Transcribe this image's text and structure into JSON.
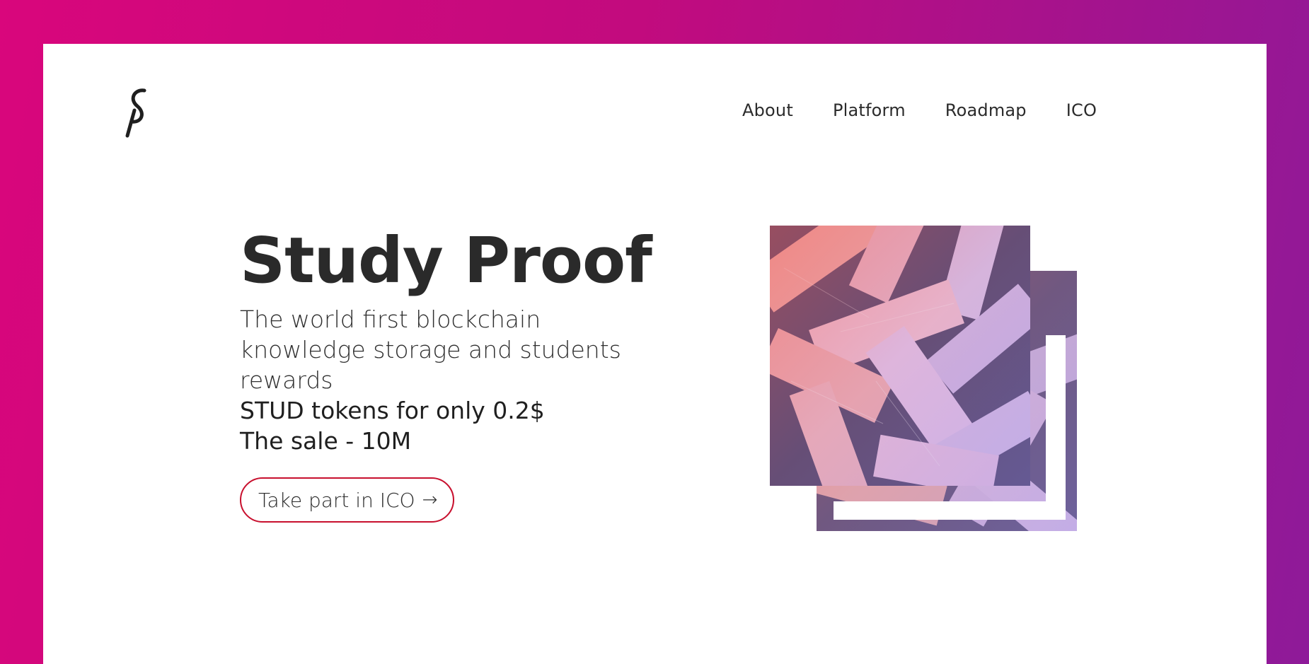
{
  "brand": {
    "logo_text": "ṡ",
    "icon": "studyproof-logo-icon"
  },
  "nav": {
    "items": [
      {
        "label": "About"
      },
      {
        "label": "Platform"
      },
      {
        "label": "Roadmap"
      },
      {
        "label": "ICO"
      }
    ]
  },
  "hero": {
    "title": "Study Proof",
    "subtitle": "The world first blockchain knowledge storage and students rewards",
    "line_tokens": "STUD tokens for only 0.2$",
    "line_sale": "The sale - 10M",
    "cta_label": "Take part in ICO",
    "cta_icon": "arrow-right-icon",
    "cta_arrow": "→"
  },
  "art": {
    "description_icon": "books-photo-icon"
  },
  "colors": {
    "background_start": "#d9067c",
    "background_end": "#8e1a99",
    "accent_border": "#c8102e",
    "text": "#2a2a2a"
  }
}
